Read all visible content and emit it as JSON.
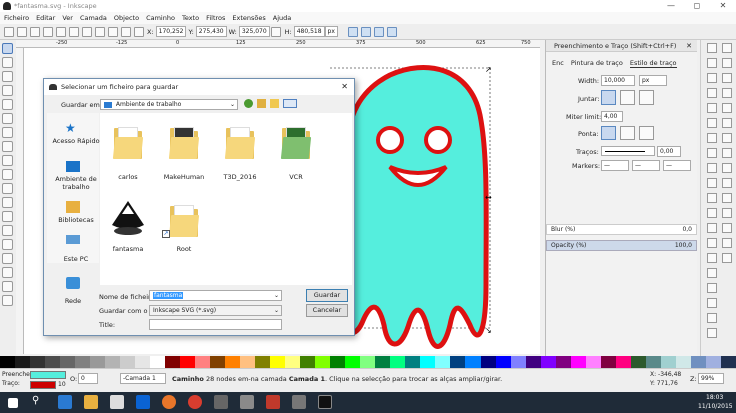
{
  "window": {
    "title": "*fantasma.svg - Inkscape",
    "minimize": "—",
    "maximize": "◻",
    "close": "✕"
  },
  "menu": [
    "Ficheiro",
    "Editar",
    "Ver",
    "Camada",
    "Objecto",
    "Caminho",
    "Texto",
    "Filtros",
    "Extensões",
    "Ajuda"
  ],
  "toolbar": {
    "x_label": "X:",
    "x": "170,252",
    "y_label": "Y:",
    "y": "275,430",
    "w_label": "W:",
    "w": "325,070",
    "h_label": "H:",
    "h": "480,518",
    "unit": "px"
  },
  "ruler_top": [
    "-250",
    "-125",
    "0",
    "125",
    "250",
    "375",
    "500",
    "625",
    "750"
  ],
  "dialog": {
    "title": "Selecionar um ficheiro para guardar",
    "save_in_label": "Guardar em:",
    "save_in_value": "Ambiente de trabalho",
    "nav": [
      "Acesso Rápido",
      "Ambiente de trabalho",
      "Bibliotecas",
      "Este PC",
      "Rede"
    ],
    "files": [
      "carlos",
      "MakeHuman",
      "T3D_2016",
      "VCR",
      "fantasma",
      "Root"
    ],
    "filename_label": "Nome de ficheiro:",
    "filename_value": "fantasma",
    "type_label": "Guardar com o tipo:",
    "type_value": "Inkscape SVG (*.svg)",
    "title_label": "Title:",
    "save_button": "Guardar",
    "cancel_button": "Cancelar"
  },
  "panel": {
    "header": "Preenchimento e Traço (Shift+Ctrl+F)",
    "tabs": [
      "Enc",
      "Pintura de traço",
      "Estilo de traço"
    ],
    "width_label": "Width:",
    "width_value": "10,000",
    "width_unit": "px",
    "join_label": "Juntar:",
    "miter_label": "Miter limit:",
    "miter_value": "4,00",
    "cap_label": "Ponta:",
    "dashes_label": "Traços:",
    "dashes_value": "0,00",
    "markers_label": "Markers:",
    "blur_label": "Blur (%)",
    "blur_value": "0,0",
    "opacity_label": "Opacity (%)",
    "opacity_value": "100,0"
  },
  "status": {
    "fill_label": "Preencher:",
    "stroke_label": "Traço:",
    "stroke_width": "10",
    "o_label": "O:",
    "o_value": "0",
    "layer": "-Camada 1",
    "message_bold": "Caminho",
    "message": " 28 nodes em-na camada ",
    "layer_bold": "Camada 1",
    "message_end": ". Clique na selecção para trocar as alças ampliar/girar.",
    "x_coord": "X: -346,48",
    "y_coord": "Y: 771,76",
    "zoom_label": "Z:",
    "zoom": "99%"
  },
  "taskbar": {
    "time": "18:03",
    "date": "11/10/2015"
  },
  "colors": {
    "ghost_fill": "#55eedd",
    "ghost_stroke": "#dd1111",
    "fill_swatch": "#55eedd",
    "stroke_swatch": "#cc0000"
  }
}
